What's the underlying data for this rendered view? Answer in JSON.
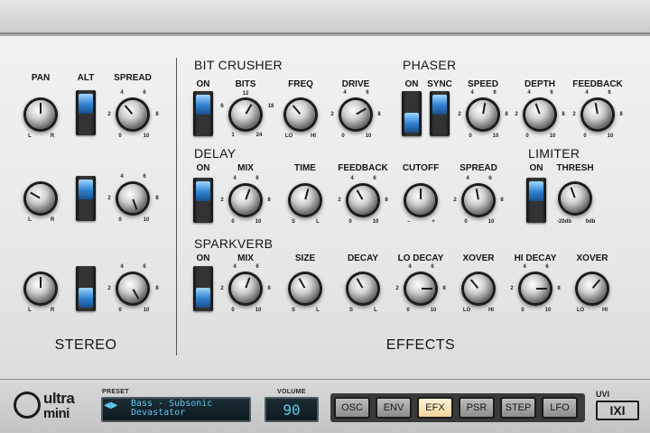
{
  "stereo": {
    "title": "STEREO",
    "headers": {
      "pan": "PAN",
      "alt": "ALT",
      "spread": "SPREAD"
    },
    "pan_ticks": {
      "left": "L",
      "right": "R"
    },
    "spread_ticks": [
      "0",
      "2",
      "4",
      "6",
      "8",
      "10"
    ],
    "rows": [
      {
        "alt_state": "up"
      },
      {
        "alt_state": "up"
      },
      {
        "alt_state": "down"
      }
    ]
  },
  "effects": {
    "title": "EFFECTS",
    "bit_crusher": {
      "title": "BIT CRUSHER",
      "on": "ON",
      "bits": "BITS",
      "freq": "FREQ",
      "drive": "DRIVE",
      "bits_ticks": [
        "1",
        "6",
        "12",
        "18",
        "24"
      ],
      "lo": "LO",
      "hi": "HI"
    },
    "phaser": {
      "title": "PHASER",
      "on": "ON",
      "sync": "SYNC",
      "speed": "SPEED",
      "depth": "DEPTH",
      "feedback": "FEEDBACK"
    },
    "delay": {
      "title": "DELAY",
      "on": "ON",
      "mix": "MIX",
      "time": "TIME",
      "feedback": "FEEDBACK",
      "cutoff": "CUTOFF",
      "spread": "SPREAD",
      "s": "S",
      "l": "L",
      "minus": "–",
      "plus": "+"
    },
    "limiter": {
      "title": "LIMITER",
      "on": "ON",
      "thresh": "THRESH",
      "min": "-20db",
      "max": "0db"
    },
    "sparkverb": {
      "title": "SPARKVERB",
      "on": "ON",
      "mix": "MIX",
      "size": "SIZE",
      "decay": "DECAY",
      "lo_decay": "LO DECAY",
      "xover1": "XOVER",
      "hi_decay": "HI DECAY",
      "xover2": "XOVER"
    }
  },
  "footer": {
    "logo_top": "ultra",
    "logo_bottom": "mini",
    "preset_label": "PRESET",
    "preset_line1": "Bass - Subsonic",
    "preset_line2": "Devastator",
    "volume_label": "VOLUME",
    "volume_value": "90",
    "tabs": [
      "OSC",
      "ENV",
      "EFX",
      "PSR",
      "STEP",
      "LFO"
    ],
    "active_tab": "EFX",
    "brand": "UVI",
    "brand_mark": "IXI"
  },
  "colors": {
    "accent_blue": "#2f7fd0",
    "lcd_text": "#5ec8ef",
    "active_tab": "#f1d49a"
  }
}
